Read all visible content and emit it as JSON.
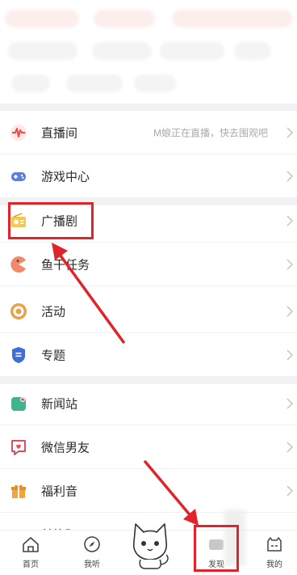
{
  "menu": {
    "live": {
      "label": "直播间",
      "hint": "M娘正在直播，快去围观吧"
    },
    "games": {
      "label": "游戏中心"
    },
    "radio_drama": {
      "label": "广播剧"
    },
    "fish_task": {
      "label": "鱼干任务"
    },
    "events": {
      "label": "活动"
    },
    "topics": {
      "label": "专题"
    },
    "news": {
      "label": "新闻站"
    },
    "wechat_bf": {
      "label": "微信男友"
    },
    "welfare": {
      "label": "福利音"
    },
    "redeem": {
      "label": "兑换码"
    }
  },
  "nav": {
    "home": "首页",
    "listen": "我听",
    "discover": "发现",
    "mine": "我的"
  },
  "colors": {
    "annotation_red": "#e0242a",
    "accent_red": "#e94b4b"
  }
}
